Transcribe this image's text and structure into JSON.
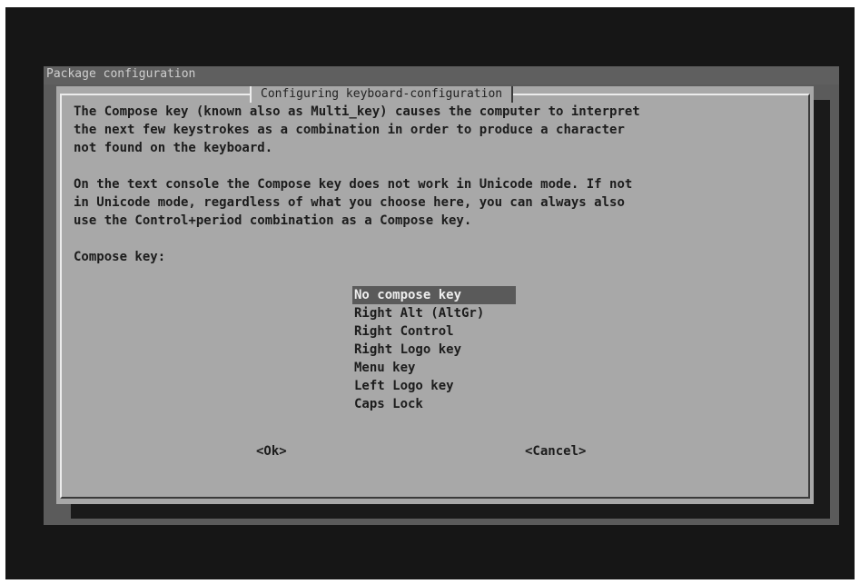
{
  "backdrop_title": "Package configuration",
  "dialog": {
    "title": "Configuring keyboard-configuration",
    "description1": "The Compose key (known also as Multi_key) causes the computer to interpret\nthe next few keystrokes as a combination in order to produce a character\nnot found on the keyboard.",
    "description2": "On the text console the Compose key does not work in Unicode mode. If not\nin Unicode mode, regardless of what you choose here, you can always also\nuse the Control+period combination as a Compose key.",
    "prompt": "Compose key:",
    "options": [
      "No compose key",
      "Right Alt (AltGr)",
      "Right Control",
      "Right Logo key",
      "Menu key",
      "Left Logo key",
      "Caps Lock"
    ],
    "selected_option": "No compose key",
    "ok_label": "<Ok>",
    "cancel_label": "<Cancel>"
  }
}
